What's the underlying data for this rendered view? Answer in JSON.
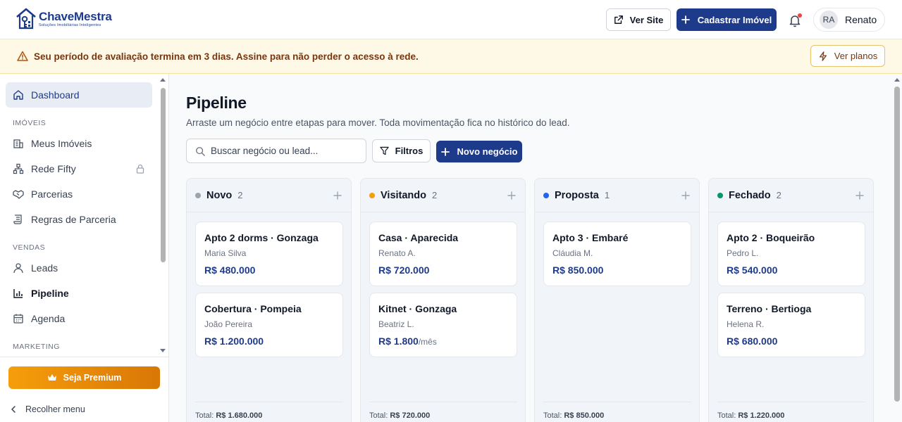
{
  "brand": {
    "name": "ChaveMestra",
    "tagline": "Soluções Imobiliárias Inteligentes"
  },
  "header": {
    "ver_site": "Ver Site",
    "cadastrar": "Cadastrar Imóvel",
    "user_initials": "RA",
    "user_name": "Renato"
  },
  "banner": {
    "text_before": "Seu período de avaliação termina em ",
    "text_bold": "3 dias",
    "text_after": ". Assine para não perder o acesso à rede.",
    "button": "Ver planos"
  },
  "sidebar": {
    "dashboard": "Dashboard",
    "section_imoveis": "IMÓVEIS",
    "meus_imoveis": "Meus Imóveis",
    "rede_fifty": "Rede Fifty",
    "parcerias": "Parcerias",
    "regras": "Regras de Parceria",
    "section_vendas": "VENDAS",
    "leads": "Leads",
    "pipeline": "Pipeline",
    "agenda": "Agenda",
    "section_marketing": "MARKETING",
    "premium": "Seja Premium",
    "collapse": "Recolher menu"
  },
  "page": {
    "title": "Pipeline",
    "subtitle": "Arraste um negócio entre etapas para mover. Toda movimentação fica no histórico do lead.",
    "search_placeholder": "Buscar negócio ou lead...",
    "filters": "Filtros",
    "new_deal": "Novo negócio"
  },
  "colors": {
    "accent": "#1e3a8a",
    "novo": "#9ca3af",
    "visitando": "#f59e0b",
    "proposta": "#2563eb",
    "fechado": "#059669"
  },
  "columns": [
    {
      "name": "Novo",
      "count": "2",
      "cards": [
        {
          "title": "Apto 2 dorms · Gonzaga",
          "person": "Maria Silva",
          "price": "R$ 480.000",
          "suffix": ""
        },
        {
          "title": "Cobertura · Pompeia",
          "person": "João Pereira",
          "price": "R$ 1.200.000",
          "suffix": ""
        }
      ],
      "total_label": "Total:",
      "total_value": "R$ 1.680.000"
    },
    {
      "name": "Visitando",
      "count": "2",
      "cards": [
        {
          "title": "Casa · Aparecida",
          "person": "Renato A.",
          "price": "R$ 720.000",
          "suffix": ""
        },
        {
          "title": "Kitnet · Gonzaga",
          "person": "Beatriz L.",
          "price": "R$ 1.800",
          "suffix": "/mês"
        }
      ],
      "total_label": "Total:",
      "total_value": "R$ 720.000"
    },
    {
      "name": "Proposta",
      "count": "1",
      "cards": [
        {
          "title": "Apto 3 · Embaré",
          "person": "Cláudia M.",
          "price": "R$ 850.000",
          "suffix": ""
        }
      ],
      "total_label": "Total:",
      "total_value": "R$ 850.000"
    },
    {
      "name": "Fechado",
      "count": "2",
      "cards": [
        {
          "title": "Apto 2 · Boqueirão",
          "person": "Pedro L.",
          "price": "R$ 540.000",
          "suffix": ""
        },
        {
          "title": "Terreno · Bertioga",
          "person": "Helena R.",
          "price": "R$ 680.000",
          "suffix": ""
        }
      ],
      "total_label": "Total:",
      "total_value": "R$ 1.220.000"
    }
  ]
}
